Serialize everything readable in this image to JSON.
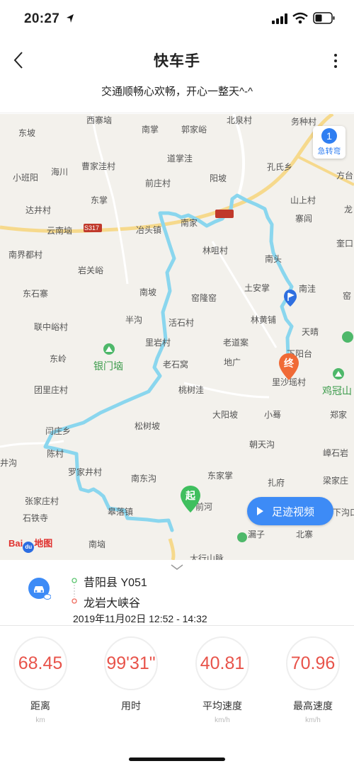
{
  "status_bar": {
    "time": "20:27"
  },
  "header": {
    "title": "快车手",
    "subtitle": "交通顺畅心欢畅，开心一整天^-^"
  },
  "map": {
    "sharp_turn": {
      "count": "1",
      "label": "急转弯"
    },
    "start_marker": "起",
    "end_marker": "终",
    "video_button": "足迹视频",
    "baidu_logo": "Bai地图",
    "places": [
      "西寨垴",
      "南掌",
      "郭家峪",
      "北泉村",
      "务种村",
      "东坡",
      "道掌洼",
      "孔氏乡",
      "小班阳",
      "海川",
      "曹家洼村",
      "前庄村",
      "阳坡",
      "方台",
      "达井村",
      "东掌",
      "山上村",
      "寨闾",
      "云南垴",
      "S317",
      "冶头镇",
      "南家",
      "林咀村",
      "南头",
      "南界都村",
      "岩关峪",
      "窑隆窑",
      "土安掌",
      "南洼",
      "东石寨",
      "南坡",
      "林黄铺",
      "联中峪村",
      "半沟",
      "活石村",
      "天晴",
      "东岭",
      "里岩村",
      "老道案",
      "下阳台",
      "银门垴",
      "老石窝",
      "地广",
      "里沙瑶村",
      "团里庄村",
      "桃树洼",
      "鸡冠山",
      "大阳坡",
      "小蓦",
      "松树坡",
      "朝天沟",
      "井沟",
      "陈村",
      "罗家井村",
      "南东沟",
      "东家掌",
      "扎府",
      "张家庄村",
      "皋落镇",
      "梁家庄",
      "石铁寺",
      "南垴",
      "漏子",
      "北寨",
      "大行山脉",
      "下沟口",
      "闫庄乡",
      "奎口",
      "嶂石岩",
      "郑家",
      "前河",
      "龙",
      "窑"
    ]
  },
  "trip": {
    "from": "昔阳县 Y051",
    "to": "龙岩大峡谷",
    "time_range": "2019年11月02日 12:52 - 14:32"
  },
  "stats": [
    {
      "value": "68.45",
      "label": "距离",
      "unit": "km"
    },
    {
      "value": "99'31\"",
      "label": "用时",
      "unit": ""
    },
    {
      "value": "40.81",
      "label": "平均速度",
      "unit": "km/h"
    },
    {
      "value": "70.96",
      "label": "最高速度",
      "unit": "km/h"
    }
  ],
  "colors": {
    "route": "#8ad6ee",
    "accent_blue": "#3d8bf6",
    "stat_red": "#e8534a",
    "start_green": "#3fbf5e",
    "end_orange": "#f06a36"
  }
}
